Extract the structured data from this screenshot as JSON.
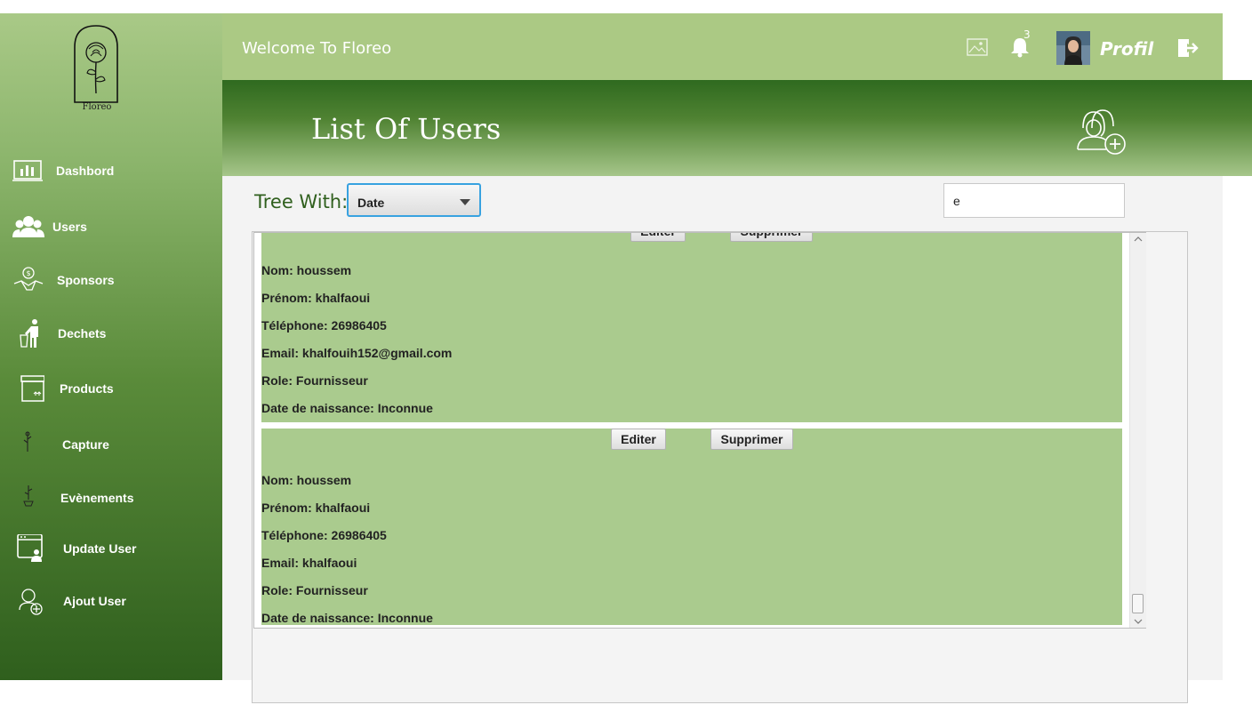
{
  "app": {
    "logo_text": "Floreo",
    "welcome": "Welcome To Floreo"
  },
  "topbar": {
    "notification_count": "3",
    "profile_label": "Profil",
    "icons": [
      "image-icon",
      "bell-icon",
      "avatar",
      "logout-icon"
    ]
  },
  "sidebar": {
    "items": [
      {
        "label": "Dashbord",
        "icon": "chart-icon"
      },
      {
        "label": "Users",
        "icon": "users-icon"
      },
      {
        "label": "Sponsors",
        "icon": "handshake-dollar-icon"
      },
      {
        "label": "Dechets",
        "icon": "trash-person-icon"
      },
      {
        "label": "Products",
        "icon": "box-icon"
      },
      {
        "label": "Capture",
        "icon": "flower-icon"
      },
      {
        "label": "Evènements",
        "icon": "flower-pot-icon"
      },
      {
        "label": "Update User",
        "icon": "browser-user-icon"
      },
      {
        "label": "Ajout User",
        "icon": "add-user-icon"
      }
    ]
  },
  "banner": {
    "title": "List Of Users",
    "action_icon": "add-user-icon"
  },
  "filter": {
    "label": "Tree With:",
    "selected": "Date",
    "search_value": "e"
  },
  "cards": [
    {
      "edit_label": "Editer",
      "delete_label": "Supprimer",
      "nom": "Nom: houssem",
      "prenom": "Prénom: khalfaoui",
      "telephone": "Téléphone: 26986405",
      "email": "Email: khalfouih152@gmail.com",
      "role": "Role: Fournisseur",
      "date": "Date de naissance: Inconnue"
    },
    {
      "edit_label": "Editer",
      "delete_label": "Supprimer",
      "nom": "Nom: houssem",
      "prenom": "Prénom: khalfaoui",
      "telephone": "Téléphone: 26986405",
      "email": "Email: khalfaoui",
      "role": "Role: Fournisseur",
      "date": "Date de naissance: Inconnue"
    }
  ],
  "colors": {
    "sidebar_top": "#a9c987",
    "sidebar_bottom": "#2f5f1d",
    "topbar": "#abc984",
    "card": "#aacb8e",
    "accent_title": "#2f5f1d"
  }
}
